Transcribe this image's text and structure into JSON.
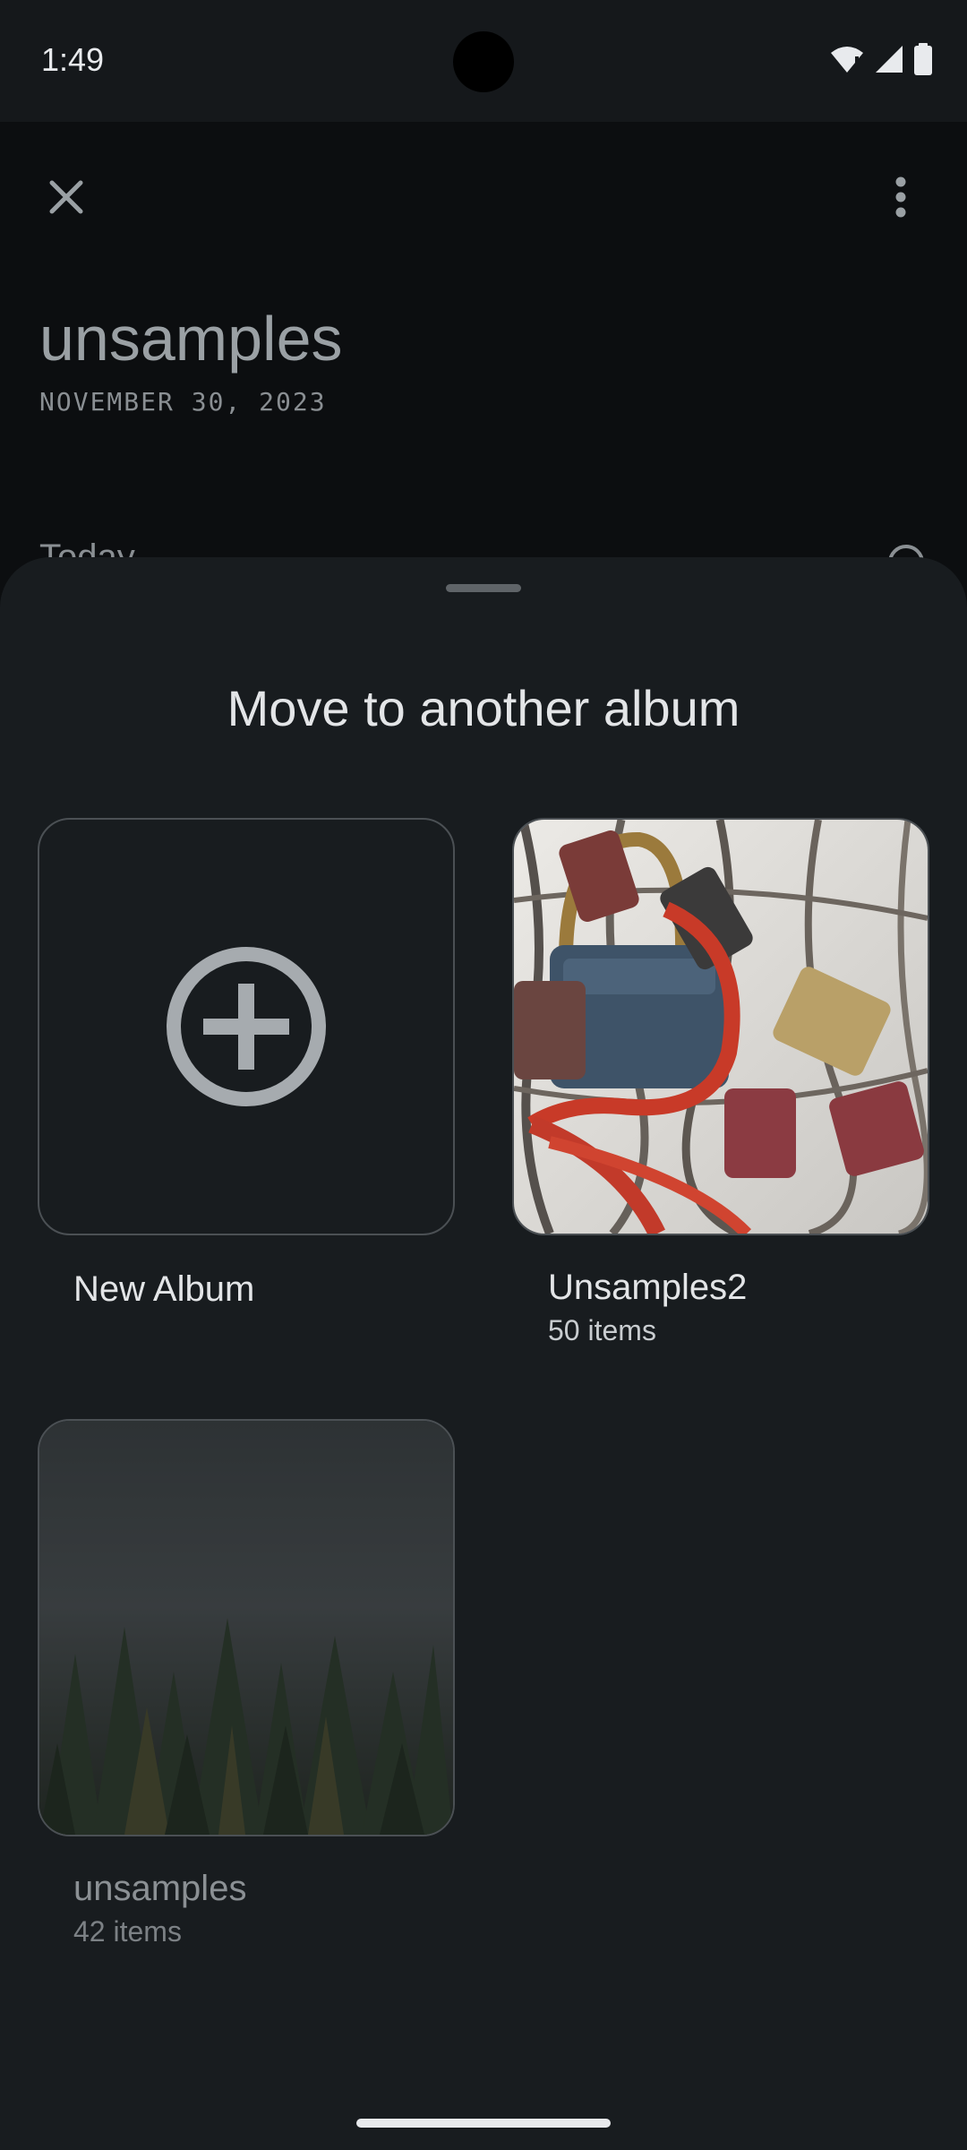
{
  "status_bar": {
    "time": "1:49",
    "icons": [
      "wifi-alert-icon",
      "cellular-signal-icon",
      "battery-icon"
    ]
  },
  "background_page": {
    "close_icon": "close-icon",
    "more_icon": "more-vertical-icon",
    "title": "unsamples",
    "date": "NOVEMBER 30, 2023",
    "section_label": "Today"
  },
  "sheet": {
    "title": "Move to another album",
    "albums": [
      {
        "name": "New Album",
        "count": "",
        "icon": "add-circle-icon"
      },
      {
        "name": "Unsamples2",
        "count": "50 items"
      },
      {
        "name": "unsamples",
        "count": "42 items"
      }
    ]
  },
  "colors": {
    "sheet_background": "#181c1f",
    "page_background": "#0c0e10",
    "accent_gray": "#a6abaf"
  }
}
